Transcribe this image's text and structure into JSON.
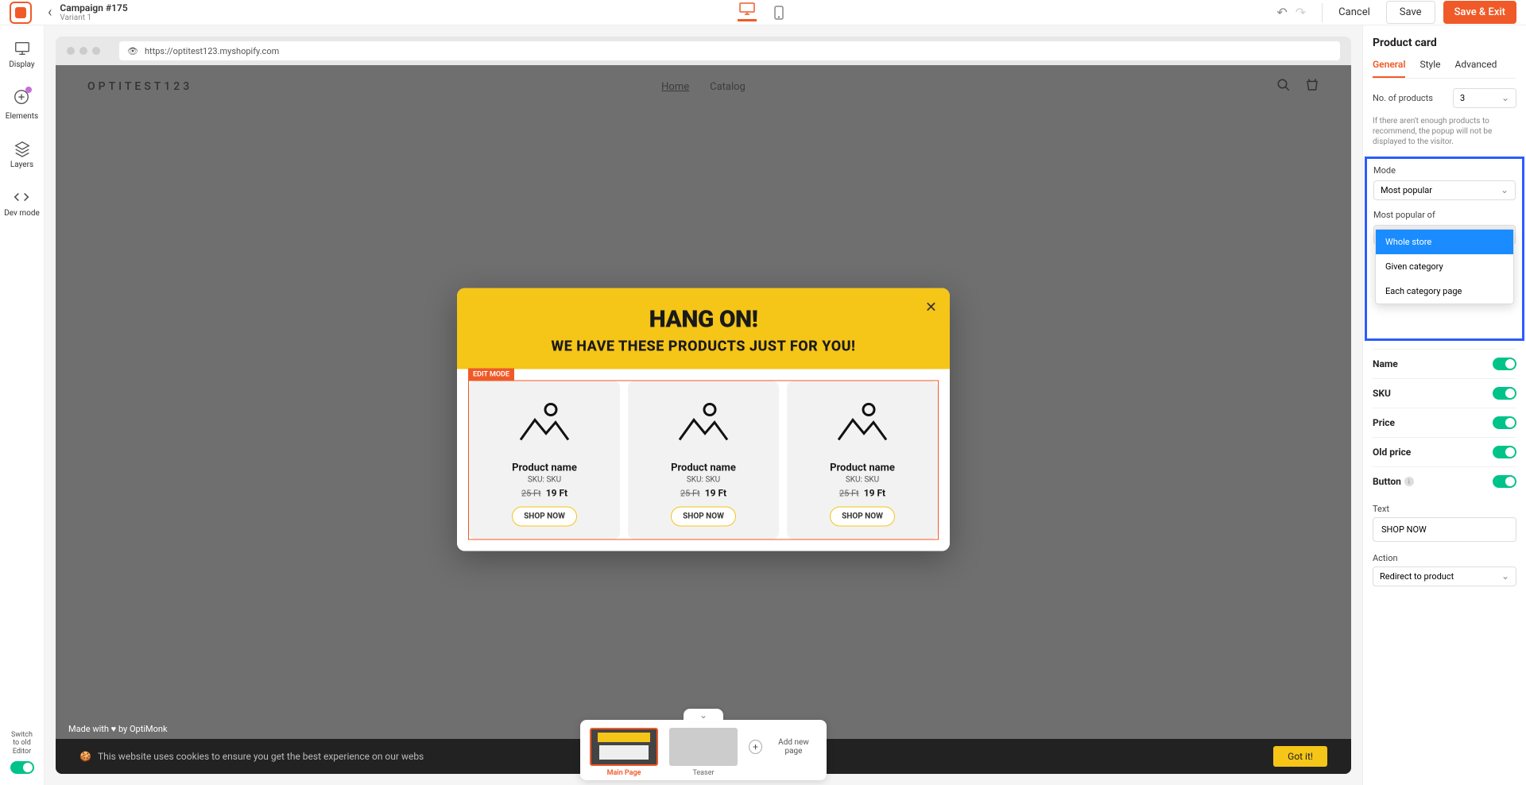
{
  "topbar": {
    "campaign": "Campaign #175",
    "variant": "Variant 1",
    "cancel": "Cancel",
    "save": "Save",
    "save_exit": "Save & Exit"
  },
  "leftnav": {
    "display": "Display",
    "elements": "Elements",
    "layers": "Layers",
    "devmode": "Dev mode",
    "switch_line1": "Switch",
    "switch_line2": "to old",
    "switch_line3": "Editor"
  },
  "browser": {
    "url": "https://optitest123.myshopify.com"
  },
  "site": {
    "logo": "OPTITEST123",
    "nav_home": "Home",
    "nav_catalog": "Catalog"
  },
  "popup": {
    "h1": "HANG ON!",
    "h2": "WE HAVE THESE PRODUCTS JUST FOR YOU!",
    "edit_badge": "EDIT MODE",
    "cards": [
      {
        "name": "Product name",
        "sku": "SKU: SKU",
        "old": "25 Ft",
        "price": "19 Ft",
        "btn": "SHOP NOW"
      },
      {
        "name": "Product name",
        "sku": "SKU: SKU",
        "old": "25 Ft",
        "price": "19 Ft",
        "btn": "SHOP NOW"
      },
      {
        "name": "Product name",
        "sku": "SKU: SKU",
        "old": "25 Ft",
        "price": "19 Ft",
        "btn": "SHOP NOW"
      }
    ]
  },
  "cookie": {
    "text": "This website uses cookies to ensure you get the best experience on our webs",
    "btn": "Got it!"
  },
  "madewith": "Made with ♥ by OptiMonk",
  "thumbs": {
    "main": "Main Page",
    "teaser": "Teaser",
    "add": "Add new page"
  },
  "rightpanel": {
    "title": "Product card",
    "tabs": {
      "general": "General",
      "style": "Style",
      "advanced": "Advanced"
    },
    "num_products_lbl": "No. of products",
    "num_products_val": "3",
    "help": "If there aren't enough products to recommend, the popup will not be displayed to the visitor.",
    "mode_lbl": "Mode",
    "mode_val": "Most popular",
    "popular_of_lbl": "Most popular of",
    "popular_of_val": "Whole store",
    "dd_options": [
      "Whole store",
      "Given category",
      "Each category page"
    ],
    "name_lbl": "Name",
    "sku_lbl": "SKU",
    "price_lbl": "Price",
    "oldprice_lbl": "Old price",
    "button_lbl": "Button",
    "text_lbl": "Text",
    "text_val": "SHOP NOW",
    "action_lbl": "Action",
    "action_val": "Redirect to product"
  }
}
